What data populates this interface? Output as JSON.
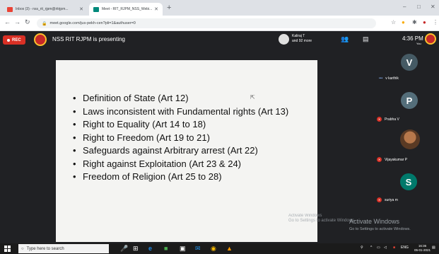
{
  "browser": {
    "tabs": [
      {
        "title": "Inbox (3) - nss_rit_rjpm@ritrjpm...",
        "active": false
      },
      {
        "title": "Meet - RIT_RJPM_NSS_Webi...",
        "active": true
      }
    ],
    "new_tab": "+",
    "url": "meet.google.com/jus-pekh-cen?pli=1&authuser=0",
    "window_controls": {
      "minimize": "–",
      "maximize": "□",
      "close": "✕"
    }
  },
  "meet": {
    "rec_label": "REC",
    "presenting_text": "NSS RIT RJPM is presenting",
    "participants_name": "Kaliraj T",
    "participants_more": "and 92 more",
    "time": "4:36 PM",
    "you_label": "You"
  },
  "slide": {
    "bullets": [
      "Definition of State (Art 12)",
      "Laws inconsistent with Fundamental rights (Art 13)",
      "Right to Equality (Art 14 to 18)",
      "Right to Freedom (Art 19 to 21)",
      "Safeguards against Arbitrary arrest (Art 22)",
      "Right against Exploitation (Art 23 & 24)",
      "Freedom of Religion (Art 25 to 28)"
    ]
  },
  "sidebar": {
    "tiles": [
      {
        "initial": "V",
        "name": "v karthik",
        "color": "#455a64"
      },
      {
        "initial": "P",
        "name": "Prabha V",
        "color": "#546e7a"
      },
      {
        "initial": "",
        "name": "Vijayakumar P",
        "color": ""
      },
      {
        "initial": "S",
        "name": "suriya m",
        "color": "#00796b"
      }
    ]
  },
  "watermark": {
    "small_title": "Activate Windows",
    "small_sub": "Go to Settings to activate Windows.",
    "title": "Activate Windows",
    "subtitle": "Go to Settings to activate Windows."
  },
  "taskbar": {
    "search_placeholder": "Type here to search",
    "lang": "ENG",
    "time": "16:36",
    "date": "05-01-2021"
  }
}
